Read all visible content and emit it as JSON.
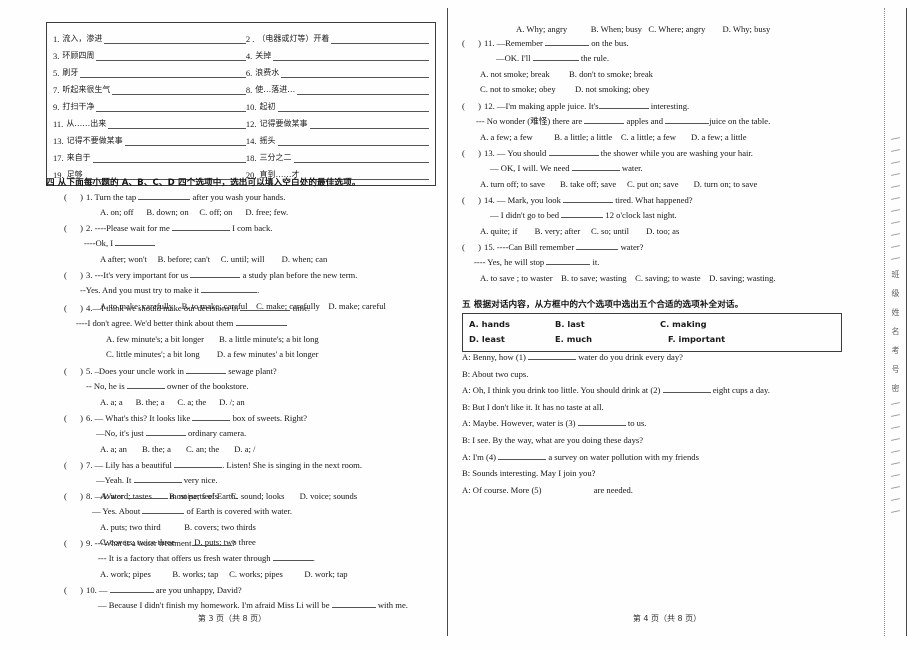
{
  "document": {
    "type": "english-exam-paper",
    "left_page_footer": "第 3 页（共 8 页）",
    "right_page_footer": "第 4 页（共 8 页）"
  },
  "margin_text": {
    "chars": [
      "班",
      "级",
      "姓",
      "名",
      "考",
      "号",
      "密"
    ]
  },
  "vocab_box": {
    "items": [
      {
        "num": "1.",
        "cn": "流入，渗进"
      },
      {
        "num": "2 .",
        "cn": "（电器或灯等）开着"
      },
      {
        "num": "3.",
        "cn": "环顾四周"
      },
      {
        "num": "4.",
        "cn": "关掉"
      },
      {
        "num": "5.",
        "cn": "刷牙"
      },
      {
        "num": "6.",
        "cn": "浪费水"
      },
      {
        "num": "7.",
        "cn": "听起来很生气"
      },
      {
        "num": "8.",
        "cn": "使…落进…"
      },
      {
        "num": "9.",
        "cn": "打扫干净"
      },
      {
        "num": "10.",
        "cn": "起初"
      },
      {
        "num": "11.",
        "cn": "从……出来"
      },
      {
        "num": "12.",
        "cn": "记得要做某事"
      },
      {
        "num": "13.",
        "cn": "记得不要做某事"
      },
      {
        "num": "14.",
        "cn": "摇头"
      },
      {
        "num": "17.",
        "cn": "来自于"
      },
      {
        "num": "18.",
        "cn": "三分之二"
      },
      {
        "num": "19.",
        "cn": "足够"
      },
      {
        "num": "20.",
        "cn": "直到……才"
      }
    ]
  },
  "section4": {
    "heading": "四 从下面每小题的 A、B、C、D 四个选项中，选出可以填入空白处的最佳选项。",
    "questions": [
      {
        "number": "1",
        "stem_a": "Turn the tap",
        "stem_b": "after you wash your hands.",
        "options": [
          "A. on; off",
          "B. down; on",
          "C. off; on",
          "D. free; few."
        ]
      },
      {
        "number": "2",
        "stem_a": "----Please wait for me",
        "stem_b": "I com back.",
        "reply_a": "----Ok, I",
        "reply_b": "",
        "options": [
          "A after; won't",
          "B. before; can't",
          "C. until; will",
          "D. when; can"
        ]
      },
      {
        "number": "3",
        "stem_a": "---It's very important for us",
        "stem_b": "a study plan before the new term.",
        "reply_a": "--Yes. And you must try to make it",
        "reply_b": ".",
        "options": [
          "A. to make; carefully",
          "B. to make; careful",
          "C. make; carefully",
          "D. make; careful"
        ]
      },
      {
        "number": "4",
        "stem_a": "—I think we should make our decisions in",
        "stem_b": "time.",
        "reply_a": "----I don't agree. We'd better think about them",
        "reply_b": ".",
        "options_row1": [
          "A. few minute's; a bit longer",
          "B. a little minute's; a bit long"
        ],
        "options_row2": [
          "C. little minutes'; a bit long",
          "D. a few minutes' a bit longer"
        ]
      },
      {
        "number": "5",
        "stem_a": "–Does your uncle work in",
        "stem_b": "sewage plant?",
        "reply_a": "-- No, he is",
        "reply_b": "owner of the bookstore.",
        "options": [
          "A. a; a",
          "B. the; a",
          "C. a; the",
          "D. /; an"
        ]
      },
      {
        "number": "6",
        "stem_a": "— What's this? It looks like",
        "stem_b": "box of sweets. Right?",
        "reply_a": "—No, it's just",
        "reply_b": "ordinary camera.",
        "options": [
          "A. a; an",
          "B. the; a",
          "C. an; the",
          "D. a; /"
        ]
      },
      {
        "number": "7",
        "stem_a": "— Lily has a beautiful",
        "stem_b": ". Listen!    She is singing in the next room.",
        "reply_a": "—Yeah. It",
        "reply_b": "very nice.",
        "options": [
          "A. word; tastes",
          "B. noise; feels",
          "C. sound; looks",
          "D. voice; sounds"
        ]
      },
      {
        "number": "8",
        "stem_a": "—Water",
        "stem_b": "most parts of Earth.",
        "reply_a": "— Yes. About",
        "reply_b": "of Earth is covered with water.",
        "options_row1": [
          "A. puts; two third",
          "B. covers; two thirds"
        ],
        "options_row2": [
          "C. covers; twice three",
          "D. puts; two three"
        ]
      },
      {
        "number": "9",
        "stem_a": "---What is a water treatment",
        "stem_b": "?",
        "reply_a": "--- It is a factory that offers us fresh    water through",
        "reply_b": ".",
        "options": [
          "A. work; pipes",
          "B. works; tap",
          "C. works; pipes",
          "D. work; tap"
        ]
      },
      {
        "number": "10",
        "stem_a": "—",
        "stem_b": "are you unhappy, David?",
        "reply_a": "— Because I didn't finish my homework. I'm afraid Miss Li will be",
        "reply_b": "with me.",
        "options": [
          "A. Why; angry",
          "B. When; busy",
          "C. Where; angry",
          "D. Why; busy"
        ]
      },
      {
        "number": "11",
        "stem_a": "—Remember",
        "stem_b": "on the bus.",
        "reply_a": "—OK. I'll",
        "reply_b": "the rule.",
        "options_row1": [
          "A. not smoke; break",
          "B. don't to smoke; break"
        ],
        "options_row2": [
          "C. not to smoke; obey",
          "D. not smoking; obey"
        ]
      },
      {
        "number": "12",
        "stem_a": "—I'm making apple juice. It's",
        "stem_b": "interesting.",
        "reply_a": "--- No wonder (难怪) there are",
        "reply_mid": "apples and",
        "reply_b": "juice on the table.",
        "options": [
          "A. a few; a few",
          "B. a little; a little",
          "C. a little; a few",
          "D. a few; a little"
        ]
      },
      {
        "number": "13",
        "stem_a": "— You should",
        "stem_b": "the shower while you are washing your hair.",
        "reply_a": "— OK, I will. We need",
        "reply_b": "water.",
        "options": [
          "A. turn off; to save",
          "B. take off; save",
          "C. put on; save",
          "D. turn on; to save"
        ]
      },
      {
        "number": "14",
        "stem_a": "— Mark, you look",
        "stem_b": "tired. What happened?",
        "reply_a": "— I didn't go to bed",
        "reply_b": "12 o'clock    last night.",
        "options": [
          "A. quite; if",
          "B. very; after",
          "C. so; until",
          "D. too; as"
        ]
      },
      {
        "number": "15",
        "stem_a": "----Can Bill remember",
        "stem_b": "water?",
        "reply_a": "---- Yes, he will stop",
        "reply_b": "it.",
        "options": [
          "A. to save ; to waster",
          "B. to save; wasting",
          "C. saving; to waste",
          "D. saving; wasting."
        ]
      }
    ]
  },
  "section5": {
    "heading": "五 根据对话内容，从方框中的六个选项中选出五个合适的选项补全对话。",
    "choices_row1": [
      "A. hands",
      "B. last",
      "C. making"
    ],
    "choices_row2": [
      "D. least",
      "E. much",
      "F. important"
    ],
    "dialogue": [
      {
        "pre": "A: Benny, how (1)",
        "post": "water do you drink every day?",
        "has_blank": true
      },
      {
        "pre": "B: About two cups.",
        "post": "",
        "has_blank": false
      },
      {
        "pre": "A: Oh, I think you drink too little. You should drink at (2)",
        "post": "eight cups a day.",
        "has_blank": true
      },
      {
        "pre": "B: But I don't like it. It has no taste at all.",
        "post": "",
        "has_blank": false
      },
      {
        "pre": "A: Maybe. However, water is (3)",
        "post": "to us.",
        "has_blank": true
      },
      {
        "pre": "B: I see. By the way, what are you doing these days?",
        "post": "",
        "has_blank": false
      },
      {
        "pre": "A: I'm (4)",
        "post": "a survey on water pollution with my friends",
        "has_blank": true
      },
      {
        "pre": "B: Sounds interesting. May I join you?",
        "post": "",
        "has_blank": false
      },
      {
        "pre": "A: Of course. More (5)",
        "post": "are needed.",
        "has_blank": true
      }
    ]
  }
}
